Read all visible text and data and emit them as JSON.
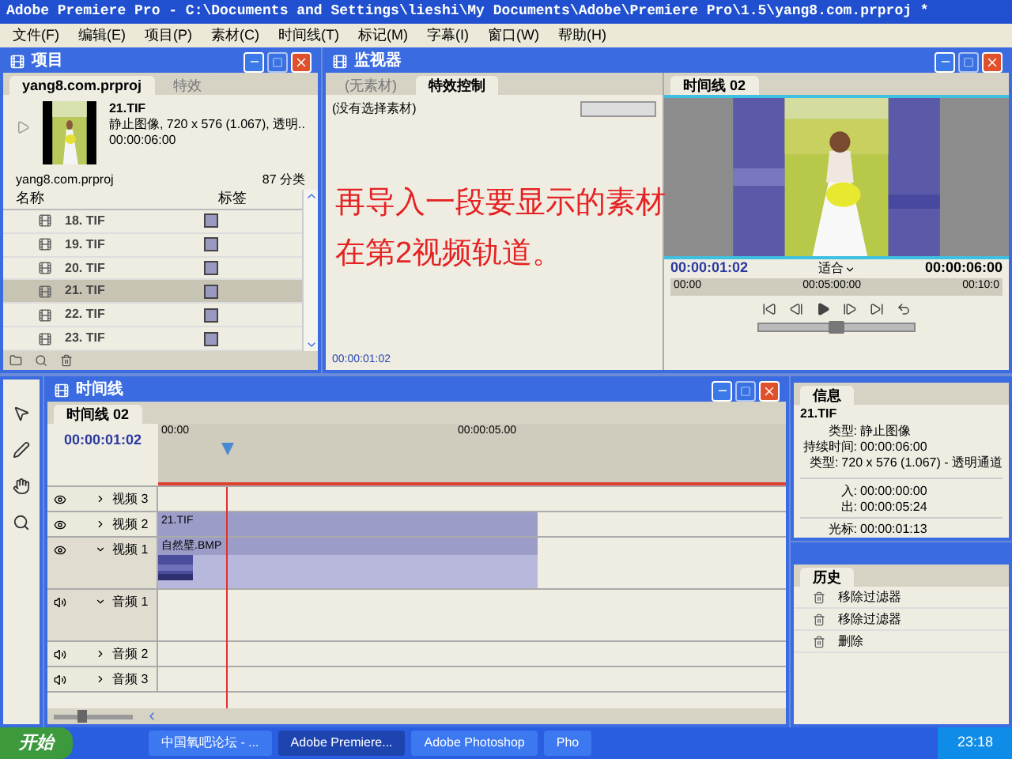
{
  "window": {
    "title": "Adobe Premiere Pro - C:\\Documents and Settings\\lieshi\\My Documents\\Adobe\\Premiere Pro\\1.5\\yang8.com.prproj *"
  },
  "menu": [
    "文件(F)",
    "编辑(E)",
    "项目(P)",
    "素材(C)",
    "时间线(T)",
    "标记(M)",
    "字幕(I)",
    "窗口(W)",
    "帮助(H)"
  ],
  "project": {
    "title": "项目",
    "tabs": [
      {
        "label": "yang8.com.prproj",
        "selected": true
      },
      {
        "label": "特效",
        "selected": false
      }
    ],
    "preview": {
      "name": "21.TIF",
      "info": "静止图像, 720 x 576 (1.067), 透明..",
      "duration": "00:00:06:00"
    },
    "project_name": "yang8.com.prproj",
    "count": "87 分类",
    "columns": [
      "名称",
      "标签"
    ],
    "rows": [
      {
        "name": "18. TIF",
        "selected": false
      },
      {
        "name": "19. TIF",
        "selected": false
      },
      {
        "name": "20. TIF",
        "selected": false
      },
      {
        "name": "21. TIF",
        "selected": true
      },
      {
        "name": "22. TIF",
        "selected": false
      },
      {
        "name": "23. TIF",
        "selected": false
      }
    ]
  },
  "monitor": {
    "title": "监视器",
    "source_tabs": [
      {
        "label": "(无素材)",
        "selected": false
      },
      {
        "label": "特效控制",
        "selected": true
      }
    ],
    "no_clip": "(没有选择素材)",
    "source_timecode": "00:00:01:02",
    "program_tab": "时间线 02",
    "timecode": "00:00:01:02",
    "zoom": "适合",
    "duration": "00:00:06:00",
    "ruler": [
      "00:00",
      "00:05:00:00",
      "00:10:0"
    ],
    "jog": {
      "level": 0.5
    }
  },
  "annotation": [
    "再导入一段要显示的素材",
    "在第2视频轨道。"
  ],
  "timeline": {
    "title": "时间线",
    "tab": "时间线 02",
    "timecode": "00:00:01:02",
    "ruler": [
      "00:00",
      "00:00:05.00"
    ],
    "zoom": {
      "level": 0.35
    },
    "tracks": [
      {
        "kind": "video",
        "name": "视频 3",
        "expanded": false
      },
      {
        "kind": "video",
        "name": "视频 2",
        "expanded": false,
        "clip": "21.TIF"
      },
      {
        "kind": "video",
        "name": "视频 1",
        "expanded": true,
        "clip": "自然壁.BMP"
      },
      {
        "kind": "audio",
        "name": "音频 1",
        "expanded": true
      },
      {
        "kind": "audio",
        "name": "音频 2",
        "expanded": false
      },
      {
        "kind": "audio",
        "name": "音频 3",
        "expanded": false
      }
    ]
  },
  "info": {
    "title": "信息",
    "file": "21.TIF",
    "clip_fields": [
      {
        "label": "类型:",
        "value": "静止图像"
      },
      {
        "label": "持续时间:",
        "value": "00:00:06:00"
      },
      {
        "label": "类型:",
        "value": "720 x 576 (1.067) - 透明通道"
      }
    ],
    "range_fields": [
      {
        "label": "入:",
        "value": "00:00:00:00"
      },
      {
        "label": "出:",
        "value": "00:00:05:24"
      }
    ],
    "cursor_field": {
      "label": "光标:",
      "value": "00:00:01:13"
    }
  },
  "history": {
    "title": "历史",
    "items": [
      "移除过滤器",
      "移除过滤器",
      "删除"
    ]
  },
  "taskbar": {
    "start": "开始",
    "tasks": [
      {
        "label": "中国氧吧论坛 - ...",
        "selected": false
      },
      {
        "label": "Adobe Premiere...",
        "selected": true
      },
      {
        "label": "Adobe Photoshop",
        "selected": false
      },
      {
        "label": "Pho",
        "selected": false
      }
    ],
    "clock": "23:18"
  }
}
